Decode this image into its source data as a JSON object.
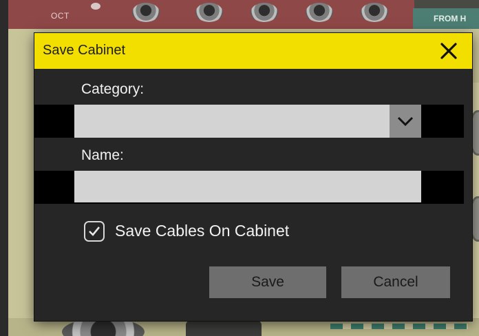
{
  "background": {
    "oct_label": "OCT",
    "from_label": "FROM H"
  },
  "dialog": {
    "title": "Save Cabinet",
    "category_label": "Category:",
    "category_value": "",
    "name_label": "Name:",
    "name_value": "",
    "name_placeholder": "",
    "save_cables_label": "Save Cables On Cabinet",
    "save_cables_checked": true,
    "save_button": "Save",
    "cancel_button": "Cancel",
    "icons": {
      "close": "close-icon",
      "dropdown": "chevron-down-icon",
      "checkmark": "check-icon"
    },
    "colors": {
      "titlebar": "#f2df00",
      "body": "#262626",
      "field": "#d3d3d3",
      "button": "#6e6e6e"
    }
  }
}
